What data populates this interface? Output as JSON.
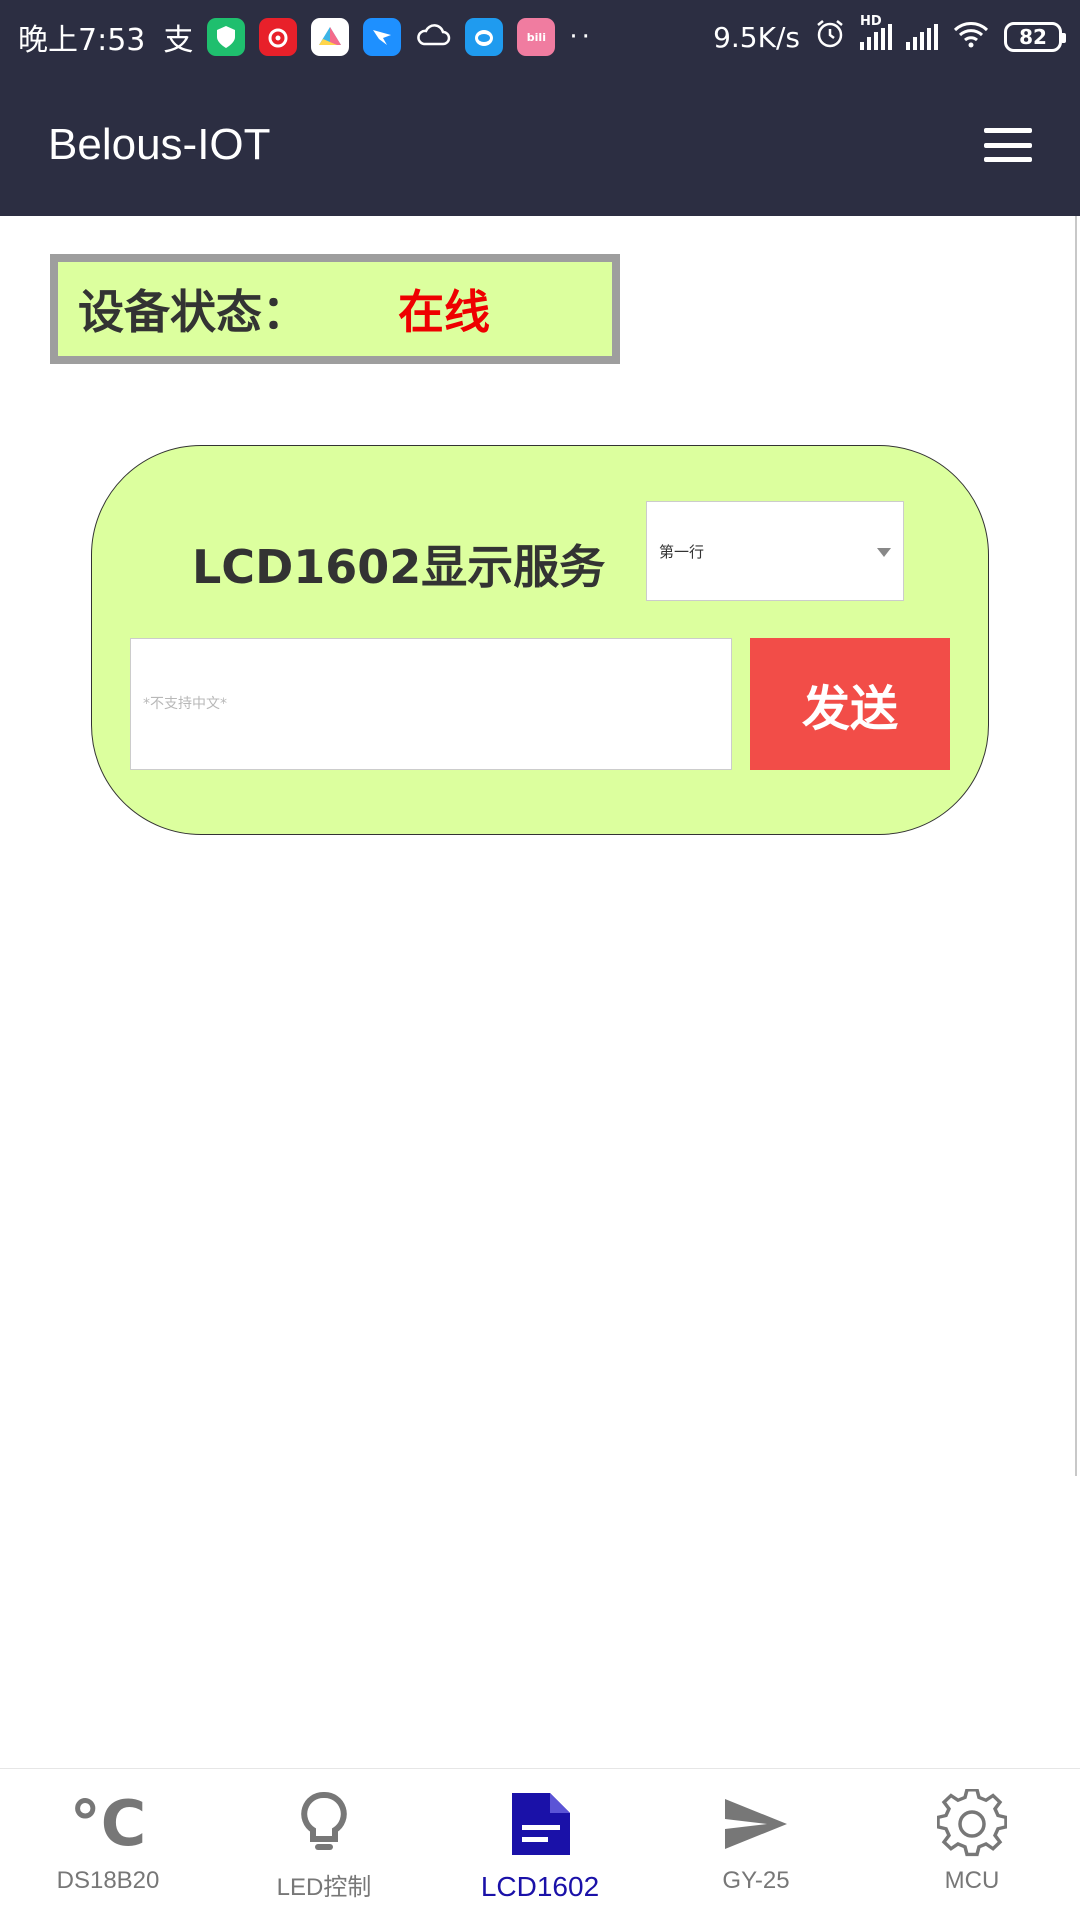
{
  "status_bar": {
    "time": "晚上7:53",
    "network_speed": "9.5K/s",
    "battery_level": "82",
    "hd_label": "HD",
    "icons": [
      "alipay-icon",
      "shield-app-icon",
      "netease-music-icon",
      "photos-app-icon",
      "dingtalk-icon",
      "cloud-icon",
      "qq-icon",
      "bilibili-icon",
      "more-dots-icon",
      "alarm-icon",
      "signal-icon",
      "wifi-icon",
      "battery-icon"
    ]
  },
  "app_bar": {
    "title": "Belous-IOT",
    "menu_icon": "hamburger-menu-icon"
  },
  "device_status": {
    "label": "设备状态：",
    "value": "在线",
    "value_color": "#ee0000"
  },
  "lcd_card": {
    "title": "LCD1602显示服务",
    "line_select": {
      "selected": "第一行"
    },
    "text_input": {
      "value": "",
      "placeholder": "*不支持中文*"
    },
    "send_label": "发送",
    "send_color": "#f24d48",
    "card_color": "#dcff9e"
  },
  "bottom_nav": {
    "items": [
      {
        "label": "DS18B20",
        "icon": "celsius-icon",
        "glyph": "°C",
        "active": false
      },
      {
        "label": "LED控制",
        "icon": "bulb-icon",
        "active": false
      },
      {
        "label": "LCD1602",
        "icon": "document-icon",
        "active": true
      },
      {
        "label": "GY-25",
        "icon": "send-arrow-icon",
        "active": false
      },
      {
        "label": "MCU",
        "icon": "gear-icon",
        "active": false
      }
    ],
    "active_color": "#1a11a8"
  },
  "colors": {
    "header_bg": "#2c2e42",
    "inactive_nav": "#777777"
  }
}
